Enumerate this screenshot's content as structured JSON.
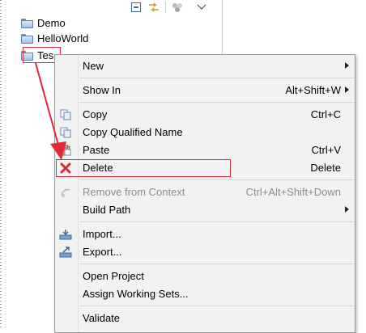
{
  "explorer": {
    "items": [
      {
        "label": "Demo",
        "icon": "folder-icon"
      },
      {
        "label": "HelloWorld",
        "icon": "folder-icon"
      },
      {
        "label": "Tes",
        "icon": "folder-icon"
      }
    ],
    "toolbar": [
      "collapse-all-icon",
      "link-with-editor-icon",
      "focus-icon",
      "view-menu-icon"
    ]
  },
  "context_menu": {
    "items": [
      {
        "label": "New",
        "accel": "",
        "submenu": true,
        "icon": "",
        "disabled": false
      },
      {
        "label": "Show In",
        "accel": "Alt+Shift+W",
        "submenu": true,
        "icon": "",
        "disabled": false
      },
      {
        "label": "Copy",
        "accel": "Ctrl+C",
        "submenu": false,
        "icon": "copy-icon",
        "disabled": false
      },
      {
        "label": "Copy Qualified Name",
        "accel": "",
        "submenu": false,
        "icon": "copy-qualified-icon",
        "disabled": false
      },
      {
        "label": "Paste",
        "accel": "Ctrl+V",
        "submenu": false,
        "icon": "paste-icon",
        "disabled": false
      },
      {
        "label": "Delete",
        "accel": "Delete",
        "submenu": false,
        "icon": "delete-icon",
        "disabled": false
      },
      {
        "label": "Remove from Context",
        "accel": "Ctrl+Alt+Shift+Down",
        "submenu": false,
        "icon": "remove-context-icon",
        "disabled": true
      },
      {
        "label": "Build Path",
        "accel": "",
        "submenu": true,
        "icon": "",
        "disabled": false
      },
      {
        "label": "Import...",
        "accel": "",
        "submenu": false,
        "icon": "import-icon",
        "disabled": false
      },
      {
        "label": "Export...",
        "accel": "",
        "submenu": false,
        "icon": "export-icon",
        "disabled": false
      },
      {
        "label": "Open Project",
        "accel": "",
        "submenu": false,
        "icon": "",
        "disabled": false
      },
      {
        "label": "Assign Working Sets...",
        "accel": "",
        "submenu": false,
        "icon": "",
        "disabled": false
      },
      {
        "label": "Validate",
        "accel": "",
        "submenu": false,
        "icon": "",
        "disabled": false
      }
    ]
  },
  "colors": {
    "annotation": "#e0293a",
    "menu_background": "#f2f2f2",
    "disabled_text": "#8e8e8e"
  }
}
